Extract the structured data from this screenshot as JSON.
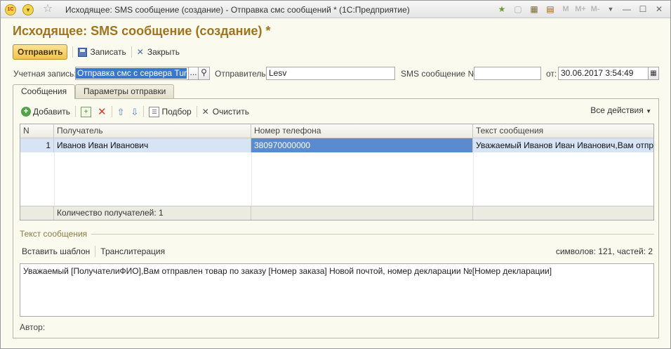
{
  "window": {
    "title": "Исходящее: SMS сообщение (создание) - Отправка смс сообщений * (1С:Предприятие)",
    "logo_text": "1С",
    "m_buttons": [
      "M",
      "M+",
      "M-"
    ]
  },
  "form": {
    "title": "Исходящее: SMS сообщение (создание) *"
  },
  "commands": {
    "send": "Отправить",
    "save": "Записать",
    "close": "Закрыть"
  },
  "fields": {
    "account_label": "Учетная запись:",
    "account_value": "Отправка смс с сервера Turbo",
    "account_choose": "...",
    "sender_label": "Отправитель:",
    "sender_value": "Lesv",
    "sms_number_label": "SMS сообщение №:",
    "sms_number_value": "",
    "date_label": "от:",
    "date_value": "30.06.2017  3:54:49"
  },
  "tabs": [
    {
      "label": "Сообщения",
      "active": true
    },
    {
      "label": "Параметры отправки",
      "active": false
    }
  ],
  "table_toolbar": {
    "add": "Добавить",
    "pick": "Подбор",
    "clear": "Очистить",
    "all_actions": "Все действия"
  },
  "recipients": {
    "columns": [
      "N",
      "Получатель",
      "Номер телефона",
      "Текст сообщения"
    ],
    "rows": [
      {
        "n": "1",
        "recipient": "Иванов Иван Иванович",
        "phone": "380970000000",
        "text": "Уважаемый Иванов Иван Иванович,Вам отпра..."
      }
    ],
    "footer": "Количество получателей: 1"
  },
  "message": {
    "section_title": "Текст сообщения",
    "insert_template": "Вставить шаблон",
    "transliterate": "Транслитерация",
    "counter": "символов: 121, частей: 2",
    "text": "Уважаемый [ПолучателиФИО],Вам отправлен товар по заказу [Номер заказа] Новой почтой, номер декларации №[Номер декларации]",
    "author_label": "Автор:"
  },
  "colors": {
    "accent": "#a0741e",
    "selection": "#3877c9",
    "row_highlight": "#d6e4f6"
  }
}
